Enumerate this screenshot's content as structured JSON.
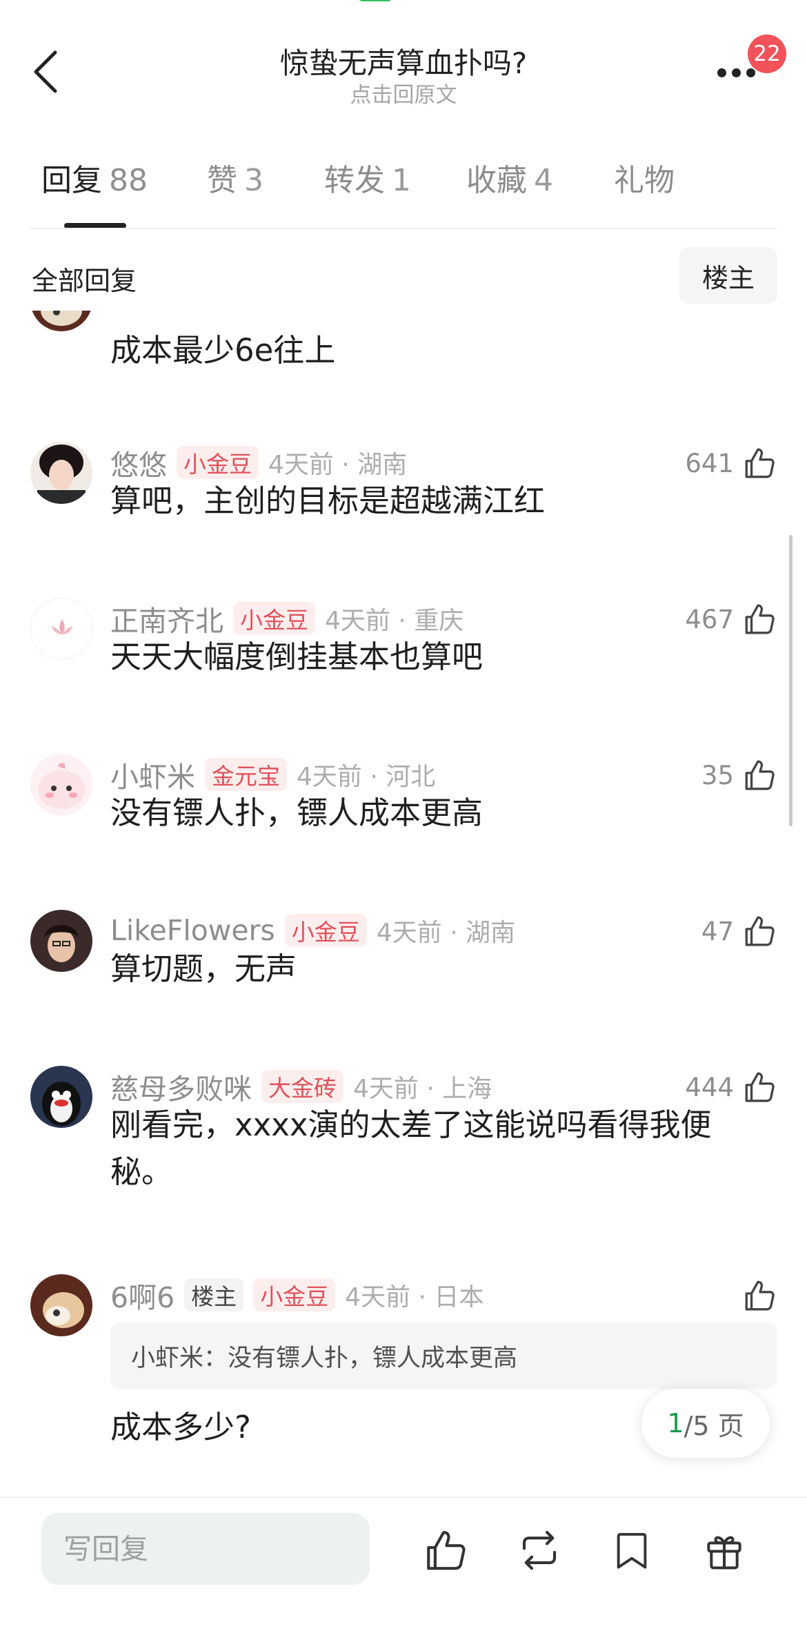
{
  "header": {
    "title": "惊蛰无声算血扑吗?",
    "subtitle": "点击回原文",
    "badge": "22"
  },
  "tabs": [
    {
      "label": "回复",
      "count": "88"
    },
    {
      "label": "赞",
      "count": "3"
    },
    {
      "label": "转发",
      "count": "1"
    },
    {
      "label": "收藏",
      "count": "4"
    },
    {
      "label": "礼物",
      "count": ""
    }
  ],
  "filter": {
    "title": "全部回复",
    "owner_button": "楼主"
  },
  "comments": [
    {
      "username": "",
      "tag": "",
      "time": "",
      "likes": "",
      "text": "成本最少6e往上"
    },
    {
      "username": "悠悠",
      "tag": "小金豆",
      "time": "4天前 · 湖南",
      "likes": "641",
      "text": "算吧，主创的目标是超越满江红"
    },
    {
      "username": "正南齐北",
      "tag": "小金豆",
      "time": "4天前 · 重庆",
      "likes": "467",
      "text": "天天大幅度倒挂基本也算吧"
    },
    {
      "username": "小虾米",
      "tag": "金元宝",
      "time": "4天前 · 河北",
      "likes": "35",
      "text": "没有镖人扑，镖人成本更高"
    },
    {
      "username": "LikeFlowers",
      "tag": "小金豆",
      "time": "4天前 · 湖南",
      "likes": "47",
      "text": "算切题，无声"
    },
    {
      "username": "慈母多败咪",
      "tag": "大金砖",
      "time": "4天前 · 上海",
      "likes": "444",
      "text": "刚看完，xxxx演的太差了这能说吗看得我便秘。"
    },
    {
      "username": "6啊6",
      "owner_tag": "楼主",
      "tag": "小金豆",
      "time": "4天前 · 日本",
      "likes": "",
      "quote": "小虾米：没有镖人扑，镖人成本更高",
      "text": "成本多少?"
    }
  ],
  "pager": {
    "current": "1",
    "rest": "/5 页"
  },
  "bottom_bar": {
    "reply_placeholder": "写回复"
  },
  "colors": {
    "accent_green": "#1a9a4b",
    "badge_red": "#f2525a",
    "tag_red": "#e0525a"
  },
  "icons": [
    "back-icon",
    "more-icon",
    "thumbs-up-icon",
    "repost-icon",
    "bookmark-icon",
    "gift-icon"
  ]
}
